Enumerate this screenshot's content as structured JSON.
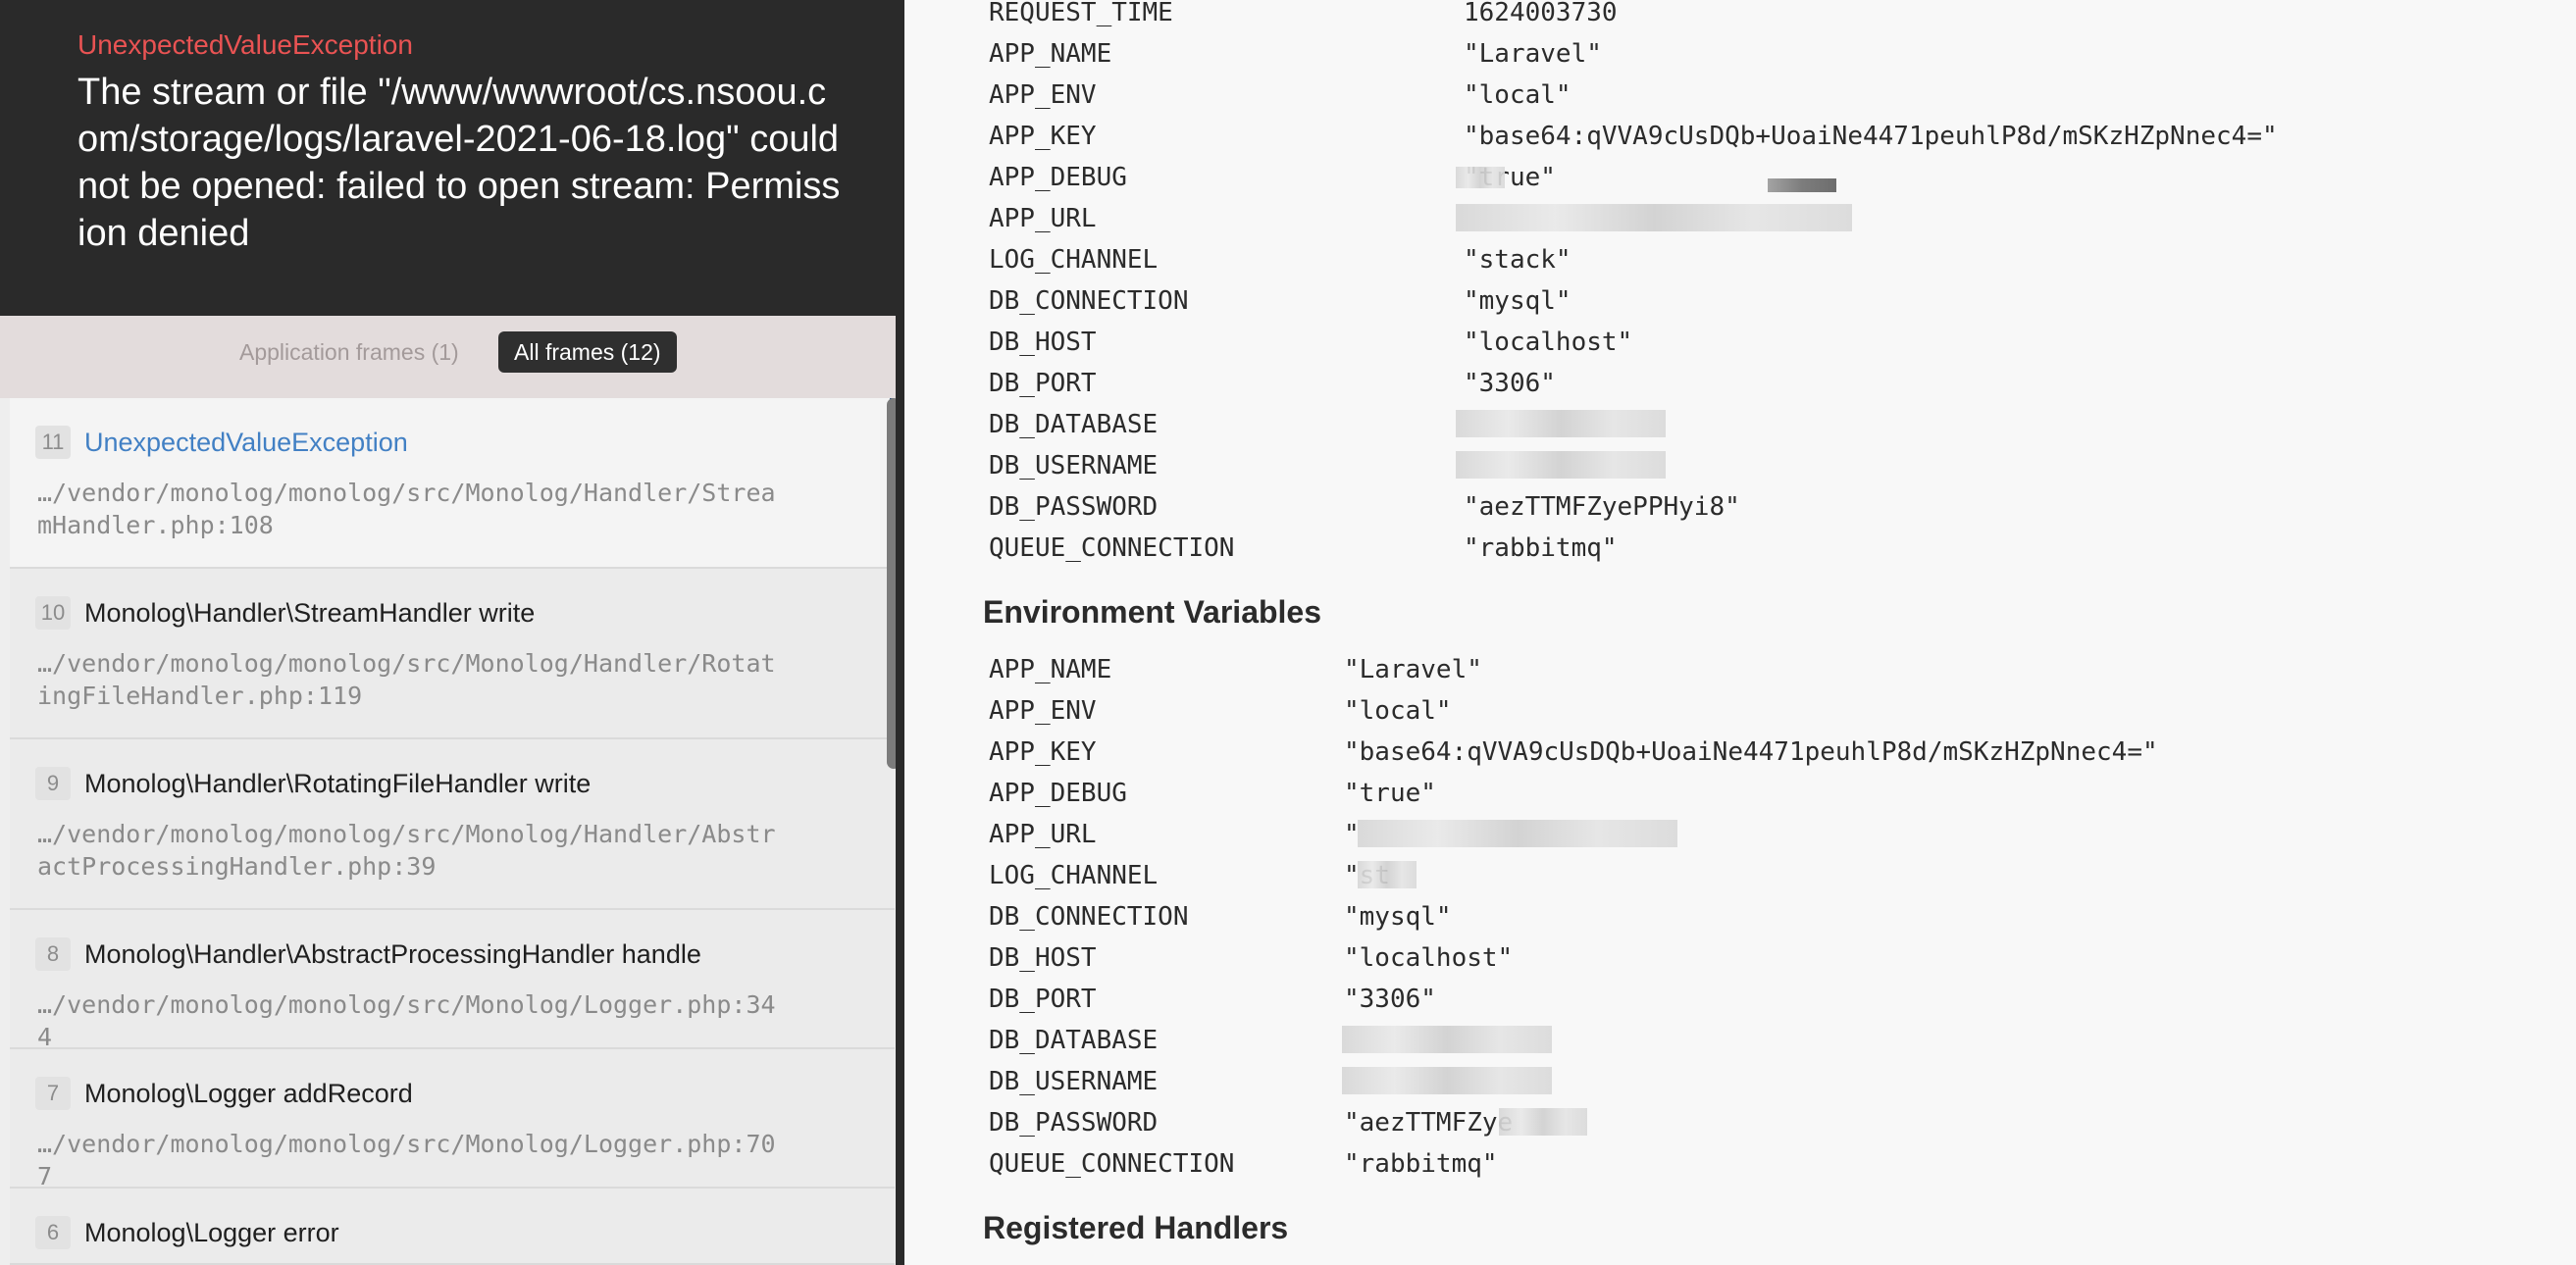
{
  "exception": {
    "class": "UnexpectedValueException",
    "message": "The stream or file \"/www/wwwroot/cs.nsoou.com/storage/logs/laravel-2021-06-18.log\" could not be opened: failed to open stream: Permission denied"
  },
  "tabs": {
    "application": "Application frames (1)",
    "all": "All frames (12)"
  },
  "frames": [
    {
      "num": "11",
      "title": "UnexpectedValueException",
      "path": "…/vendor/monolog/monolog/src/Monolog/Handler/StreamHandler.php:108"
    },
    {
      "num": "10",
      "title": "Monolog\\Handler\\StreamHandler write",
      "path": "…/vendor/monolog/monolog/src/Monolog/Handler/RotatingFileHandler.php:119"
    },
    {
      "num": "9",
      "title": "Monolog\\Handler\\RotatingFileHandler write",
      "path": "…/vendor/monolog/monolog/src/Monolog/Handler/AbstractProcessingHandler.php:39"
    },
    {
      "num": "8",
      "title": "Monolog\\Handler\\AbstractProcessingHandler handle",
      "path": "…/vendor/monolog/monolog/src/Monolog/Logger.php:344"
    },
    {
      "num": "7",
      "title": "Monolog\\Logger addRecord",
      "path": "…/vendor/monolog/monolog/src/Monolog/Logger.php:707"
    },
    {
      "num": "6",
      "title": "Monolog\\Logger error",
      "path": ""
    }
  ],
  "server_vars": [
    {
      "key": "REQUEST_TIME",
      "value": "1624003730"
    },
    {
      "key": "APP_NAME",
      "value": "\"Laravel\""
    },
    {
      "key": "APP_ENV",
      "value": "\"local\""
    },
    {
      "key": "APP_KEY",
      "value": "\"base64:qVVA9cUsDQb+UoaiNe4471peuhlP8d/mSKzHZpNnec4=\""
    },
    {
      "key": "APP_DEBUG",
      "value": "\"true\""
    },
    {
      "key": "APP_URL",
      "value": ""
    },
    {
      "key": "LOG_CHANNEL",
      "value": "\"stack\""
    },
    {
      "key": "DB_CONNECTION",
      "value": "\"mysql\""
    },
    {
      "key": "DB_HOST",
      "value": "\"localhost\""
    },
    {
      "key": "DB_PORT",
      "value": "\"3306\""
    },
    {
      "key": "DB_DATABASE",
      "value": ""
    },
    {
      "key": "DB_USERNAME",
      "value": ""
    },
    {
      "key": "DB_PASSWORD",
      "value": "\"aezTTMFZyePPHyi8\""
    },
    {
      "key": "QUEUE_CONNECTION",
      "value": "\"rabbitmq\""
    }
  ],
  "env_title": "Environment Variables",
  "env_vars": [
    {
      "key": "APP_NAME",
      "value": "\"Laravel\""
    },
    {
      "key": "APP_ENV",
      "value": "\"local\""
    },
    {
      "key": "APP_KEY",
      "value": "\"base64:qVVA9cUsDQb+UoaiNe4471peuhlP8d/mSKzHZpNnec4=\""
    },
    {
      "key": "APP_DEBUG",
      "value": "\"true\""
    },
    {
      "key": "APP_URL",
      "value": "\""
    },
    {
      "key": "LOG_CHANNEL",
      "value": "\"st"
    },
    {
      "key": "DB_CONNECTION",
      "value": "\"mysql\""
    },
    {
      "key": "DB_HOST",
      "value": "\"localhost\""
    },
    {
      "key": "DB_PORT",
      "value": "\"3306\""
    },
    {
      "key": "DB_DATABASE",
      "value": ""
    },
    {
      "key": "DB_USERNAME",
      "value": ""
    },
    {
      "key": "DB_PASSWORD",
      "value": "\"aezTTMFZye"
    },
    {
      "key": "QUEUE_CONNECTION",
      "value": "\"rabbitmq\""
    }
  ],
  "handlers_title": "Registered Handlers"
}
